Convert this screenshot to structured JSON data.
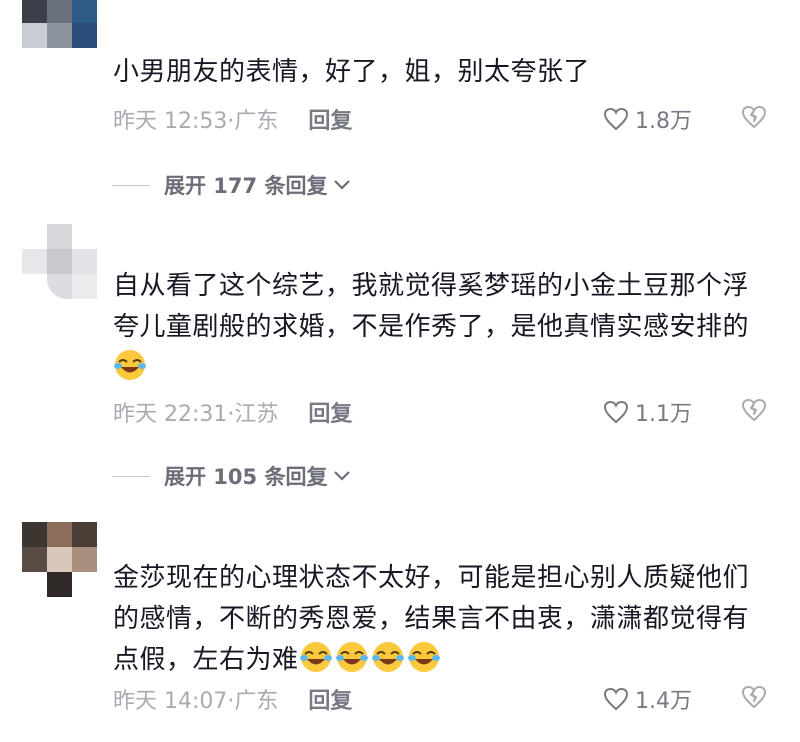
{
  "comments": [
    {
      "username": "…",
      "text": "小男朋友的表情，好了，姐，别太夸张了",
      "time": "昨天 12:53·广东",
      "reply_label": "回复",
      "likes": "1.8万",
      "expand": "展开 177 条回复"
    },
    {
      "text": "自从看了这个综艺，我就觉得奚梦瑶的小金土豆那个浮夸儿童剧般的求婚，不是作秀了，是他真情实感安排的",
      "emoji_count": 1,
      "time": "昨天 22:31·江苏",
      "reply_label": "回复",
      "likes": "1.1万",
      "expand": "展开 105 条回复"
    },
    {
      "text": "金莎现在的心理状态不太好，可能是担心别人质疑他们的感情，不断的秀恩爱，结果言不由衷，潇潇都觉得有点假，左右为难",
      "emoji_count": 4,
      "time": "昨天 14:07·广东",
      "reply_label": "回复",
      "likes": "1.4万"
    }
  ],
  "icons": {
    "like": "heart-outline-icon",
    "dislike": "broken-heart-icon",
    "expand": "chevron-down-icon",
    "emoji": "laughing-crying-emoji"
  },
  "colors": {
    "text": "#161823",
    "meta": "#a9abb3",
    "secondary": "#777a83"
  }
}
